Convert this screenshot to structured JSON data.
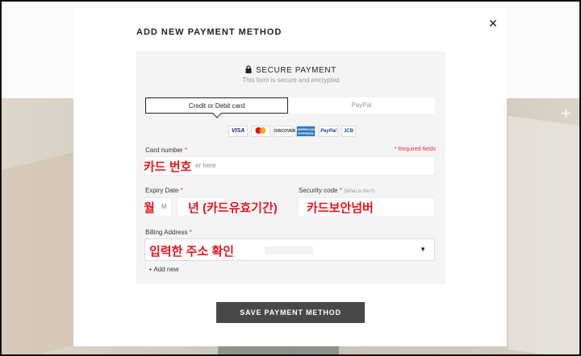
{
  "modal": {
    "title": "ADD NEW PAYMENT METHOD",
    "close_icon": "×"
  },
  "secure": {
    "title": "SECURE PAYMENT",
    "subtitle": "This form is secure and encrypted",
    "icon": "lock-icon"
  },
  "tabs": [
    {
      "label": "Credit or Debit card",
      "active": true
    },
    {
      "label": "PayPal",
      "active": false
    }
  ],
  "card_logos": [
    "VISA",
    "mastercard",
    "DISCOVER",
    "AMERICAN EXPRESS",
    "PayPal",
    "JCB"
  ],
  "form": {
    "card_number_label": "Card number",
    "required_mark": "*",
    "required_note": "* Required fields",
    "card_number_placeholder": "er here",
    "expiry_label": "Expiry Date",
    "month_value": "M",
    "security_label": "Security code",
    "security_hint": "(What is this?)",
    "billing_label": "Billing Address",
    "add_new": "+ Add new"
  },
  "annotations": {
    "card_number": "카드 번호",
    "month": "월",
    "year": "년 (카드유효기간)",
    "cvv": "카드보안넘버",
    "address": "입력한 주소 확인"
  },
  "save_button": "SAVE PAYMENT METHOD",
  "background": {
    "plus_icon": "+"
  },
  "colors": {
    "accent_red": "#e8131b",
    "button": "#484848"
  }
}
